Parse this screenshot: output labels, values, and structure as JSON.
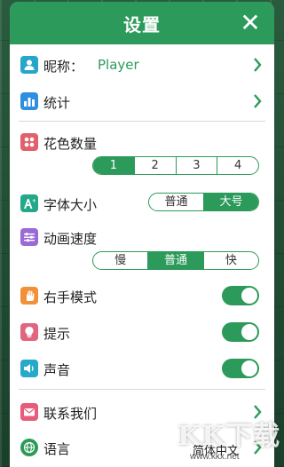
{
  "header": {
    "title": "设置",
    "close_glyph": "✕"
  },
  "nickname": {
    "label": "昵称：",
    "value": "Player"
  },
  "stats": {
    "label": "统计"
  },
  "suits": {
    "label": "花色数量",
    "options": [
      "1",
      "2",
      "3",
      "4"
    ],
    "selected": "1"
  },
  "font_size": {
    "label": "字体大小",
    "options": [
      "普通",
      "大号"
    ],
    "selected": "大号"
  },
  "anim_speed": {
    "label": "动画速度",
    "options": [
      "慢",
      "普通",
      "快"
    ],
    "selected": "普通"
  },
  "right_hand": {
    "label": "右手模式",
    "on": true
  },
  "hint": {
    "label": "提示",
    "on": true
  },
  "sound": {
    "label": "声音",
    "on": true
  },
  "contact": {
    "label": "联系我们"
  },
  "language": {
    "label": "语言",
    "value": "简体中文"
  },
  "watermark": {
    "text": "KK下载",
    "url": "www.kkx.net"
  },
  "colors": {
    "accent": "#2b9a5a",
    "nickname_value": "#2b9a5a"
  }
}
